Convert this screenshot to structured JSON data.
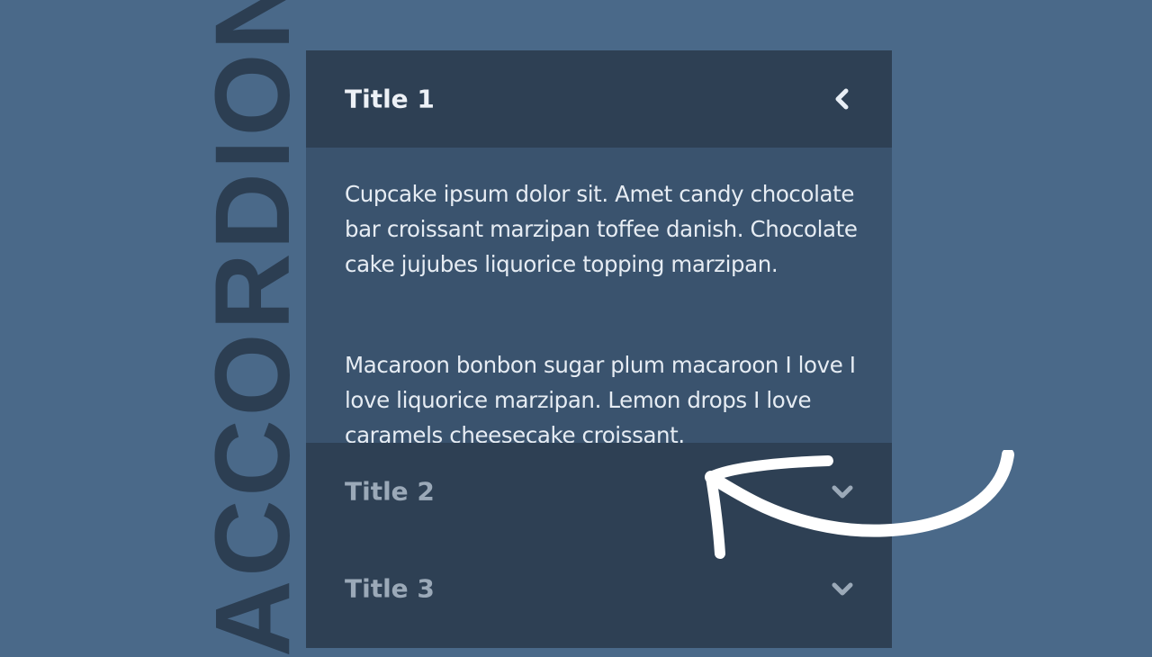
{
  "heading": {
    "vertical_word": "ACCORDION"
  },
  "accordion": {
    "items": [
      {
        "title": "Title 1",
        "icon": "chevron-left-icon",
        "expanded": true,
        "paragraphs": [
          "Cupcake ipsum dolor sit. Amet candy chocolate bar croissant marzipan toffee danish. Chocolate cake jujubes liquorice topping marzipan.",
          "Macaroon bonbon sugar plum macaroon I love I love liquorice marzipan. Lemon drops I love caramels cheesecake croissant."
        ]
      },
      {
        "title": "Title 2",
        "icon": "chevron-down-icon",
        "expanded": false
      },
      {
        "title": "Title 3",
        "icon": "chevron-down-icon",
        "expanded": false
      }
    ]
  },
  "decoration": {
    "arrow_icon": "curved-arrow-icon"
  },
  "colors": {
    "page_background": "#4a6989",
    "accordion_header": "#2e4054",
    "accordion_panel": "#3a536e",
    "vertical_word": "#2c3e52",
    "text_light": "#e6ecf3",
    "title_muted": "#9ba9b8",
    "arrow": "#ffffff"
  }
}
